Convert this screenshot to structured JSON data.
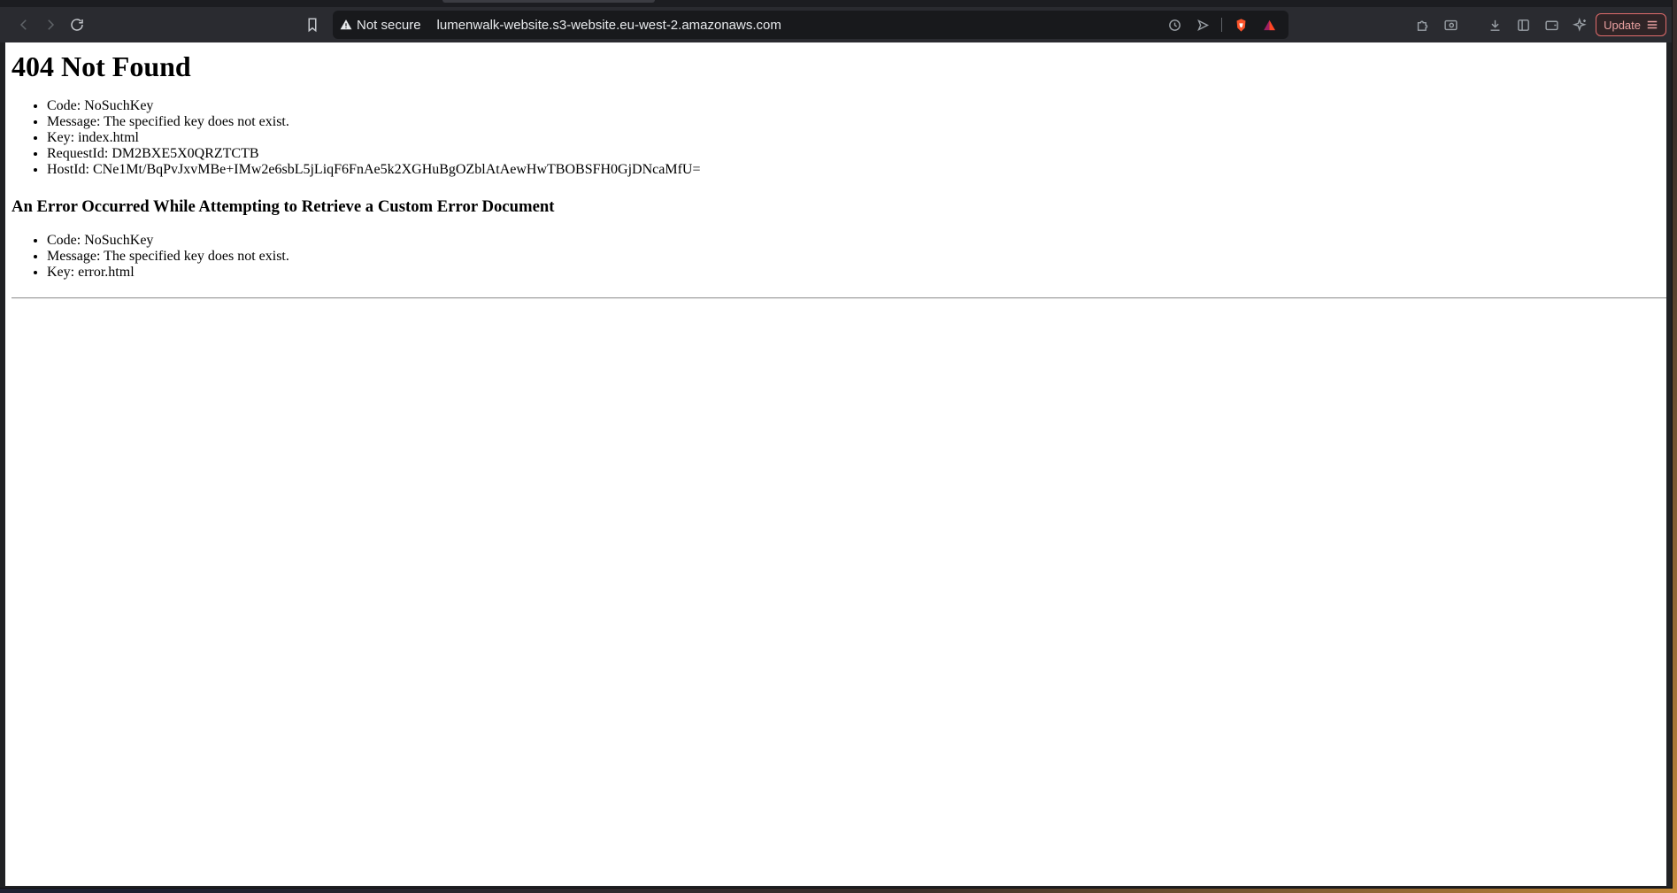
{
  "browser": {
    "security_label": "Not secure",
    "url": "lumenwalk-website.s3-website.eu-west-2.amazonaws.com",
    "update_label": "Update",
    "icons": {
      "back": "back-arrow-icon",
      "forward": "forward-arrow-icon",
      "reload": "reload-icon",
      "bookmark": "bookmark-icon",
      "warning": "warning-triangle-icon",
      "history": "history-icon",
      "send": "send-icon",
      "brave": "brave-shield-icon",
      "rewards": "brave-rewards-icon",
      "extensions": "puzzle-icon",
      "screenshot": "screenshot-icon",
      "download": "download-icon",
      "sidebar": "sidebar-icon",
      "wallet": "wallet-icon",
      "leo": "leo-sparkle-icon",
      "menu": "hamburger-menu-icon"
    },
    "colors": {
      "brave": "#fb542b",
      "update_border": "#e06c6c"
    }
  },
  "page": {
    "title": "404 Not Found",
    "details": [
      "Code: NoSuchKey",
      "Message: The specified key does not exist.",
      "Key: index.html",
      "RequestId: DM2BXE5X0QRZTCTB",
      "HostId: CNe1Mt/BqPvJxvMBe+IMw2e6sbL5jLiqF6FnAe5k2XGHuBgOZblAtAewHwTBOBSFH0GjDNcaMfU="
    ],
    "subtitle": "An Error Occurred While Attempting to Retrieve a Custom Error Document",
    "error_details": [
      "Code: NoSuchKey",
      "Message: The specified key does not exist.",
      "Key: error.html"
    ]
  }
}
